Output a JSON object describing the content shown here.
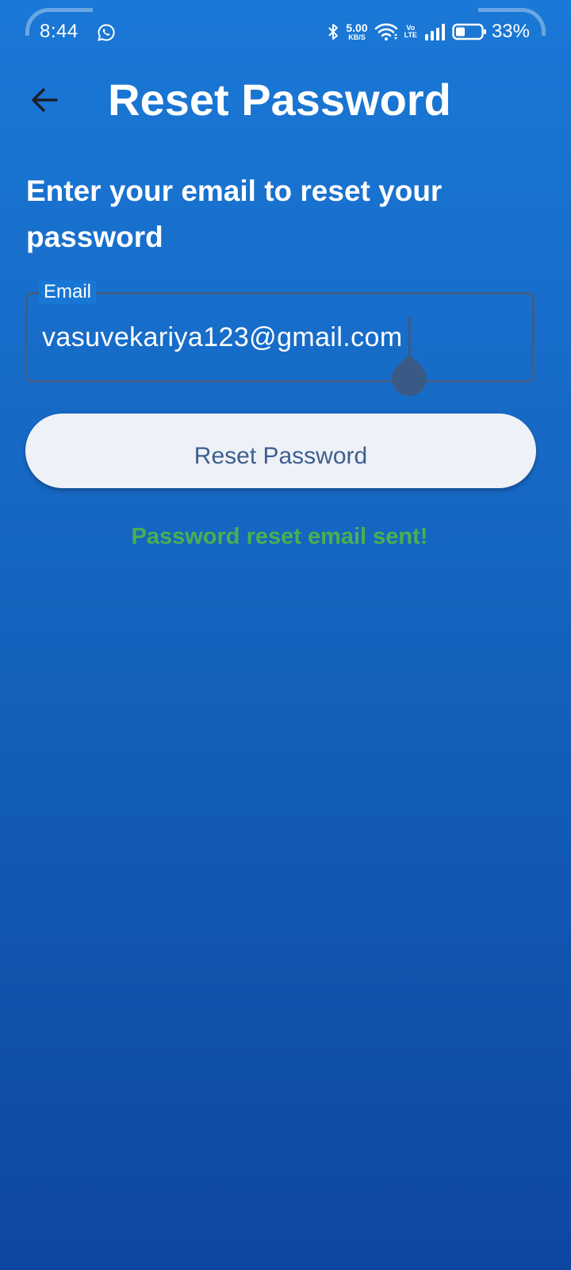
{
  "status_bar": {
    "time": "8:44",
    "net_speed_value": "5.00",
    "net_speed_unit": "KB/S",
    "volte_top": "Vo",
    "volte_bottom": "LTE",
    "battery_percent": "33%",
    "icons": [
      "whatsapp-icon",
      "bluetooth-icon",
      "wifi-icon",
      "signal-icon",
      "battery-icon"
    ]
  },
  "header": {
    "back_icon": "arrow-left-icon",
    "title": "Reset Password"
  },
  "main": {
    "instruction": "Enter your email to reset your password",
    "email_field": {
      "label": "Email",
      "value": "vasuvekariya123@gmail.com"
    },
    "reset_button_label": "Reset Password",
    "success_message": "Password reset email sent!"
  },
  "colors": {
    "background_top": "#1a78d6",
    "background_bottom": "#0d47a1",
    "button_background": "#eff1f8",
    "button_text": "#3d5f8f",
    "success_text": "#4caf50"
  }
}
